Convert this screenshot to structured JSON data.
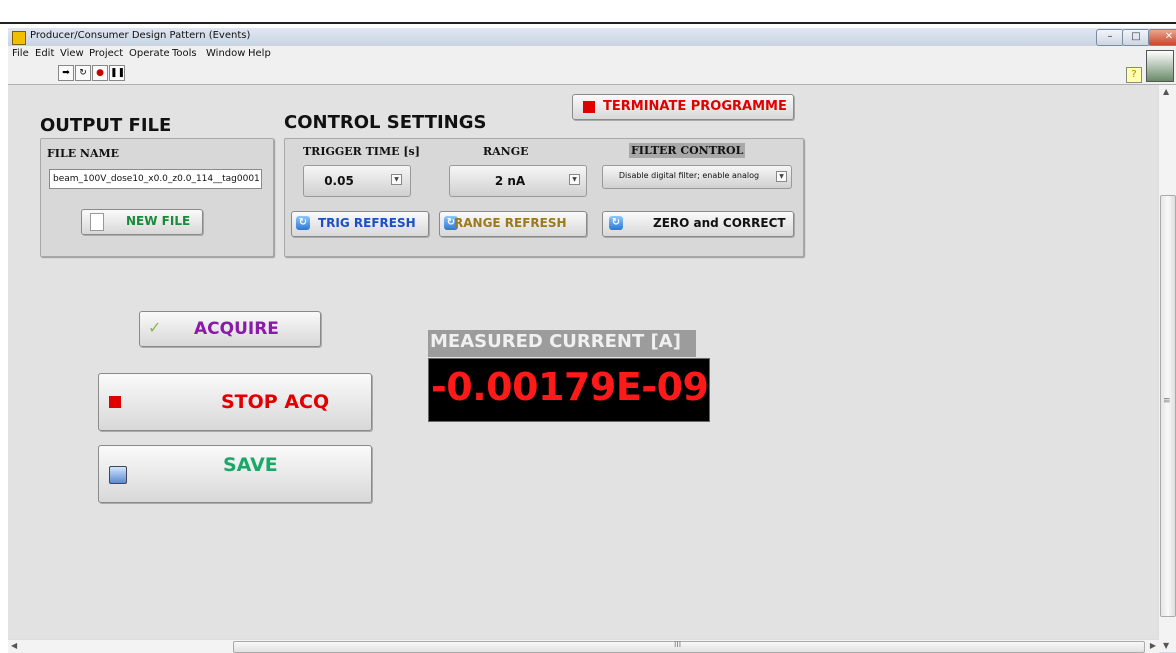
{
  "window": {
    "title": "Producer/Consumer Design Pattern (Events)",
    "controls": [
      "–",
      "□",
      "✕"
    ]
  },
  "menu": [
    "File",
    "Edit",
    "View",
    "Project",
    "Operate",
    "Tools",
    "Window",
    "Help"
  ],
  "toolbar": {
    "run_icon": "run-arrow-icon",
    "run_continuous_icon": "run-continuously-icon",
    "abort_icon": "abort-icon",
    "pause_icon": "pause-icon",
    "help_label": "?"
  },
  "output_file": {
    "heading": "OUTPUT FILE",
    "file_name_label": "FILE NAME",
    "file_name_value": "beam_100V_dose10_x0.0_z0.0_114__tag0001",
    "new_file_button": "NEW FILE"
  },
  "control_settings": {
    "heading": "CONTROL SETTINGS",
    "trigger_time_label": "TRIGGER TIME [s]",
    "trigger_time_value": "0.05",
    "range_label": "RANGE",
    "range_value": "2 nA",
    "filter_label": "FILTER CONTROL",
    "filter_value": "Disable digital filter; enable analog",
    "trig_refresh_button": "TRIG REFRESH",
    "range_refresh_button": "RANGE REFRESH",
    "zero_correct_button": "ZERO and CORRECT"
  },
  "terminate_button": "TERMINATE PROGRAMME",
  "acquire_button": "ACQUIRE",
  "stop_acq_button": "STOP ACQ",
  "save_button": "SAVE",
  "measurement": {
    "label": "MEASURED CURRENT [A]",
    "value": "-0.00179E-09"
  },
  "colors": {
    "terminate_text": "#e00000",
    "new_file_text": "#1a8a3a",
    "trig_refresh_text": "#1a4fc8",
    "range_refresh_text": "#9a7a1a",
    "acquire_text": "#8a1aa8",
    "stop_text": "#e00000",
    "save_text": "#1aa86a",
    "display_text": "#ff1a1a"
  },
  "scroll": {
    "h_mark": "III",
    "v_mark": "≡"
  }
}
